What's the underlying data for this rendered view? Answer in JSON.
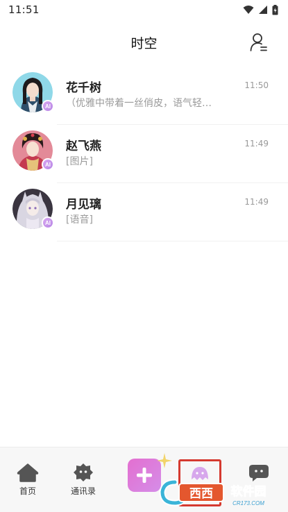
{
  "status_bar": {
    "time": "11:51"
  },
  "header": {
    "title": "时空"
  },
  "chats": [
    {
      "name": "花千树",
      "preview": "（优雅中带着一丝俏皮，语气轻…",
      "time": "11:50",
      "badge": "AI"
    },
    {
      "name": "赵飞燕",
      "preview": "[图片]",
      "time": "11:49",
      "badge": "AI"
    },
    {
      "name": "月见璃",
      "preview": "[语音]",
      "time": "11:49",
      "badge": "AI"
    }
  ],
  "nav": {
    "home_label": "首页",
    "contacts_label": "通讯录"
  },
  "watermark": {
    "brand": "西西软件园",
    "url": "CR173.COM"
  },
  "colors": {
    "accent": "#d77ad8",
    "highlight": "#d53a30"
  }
}
